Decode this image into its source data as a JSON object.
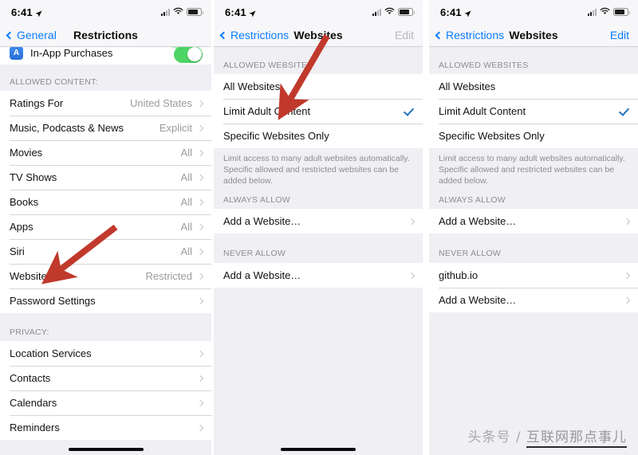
{
  "statusbar": {
    "time": "6:41",
    "location_icon": "location-arrow-icon",
    "signal_icon": "cellular-signal-icon",
    "wifi_icon": "wifi-icon",
    "battery_icon": "battery-icon"
  },
  "panel1": {
    "nav": {
      "back_label": "General",
      "title": "Restrictions",
      "right_label": ""
    },
    "partial_row": {
      "label": "In-App Purchases",
      "toggle_state": "on"
    },
    "sections": [
      {
        "header": "ALLOWED CONTENT:",
        "rows": [
          {
            "label": "Ratings For",
            "value": "United States",
            "accessory": "chevron"
          },
          {
            "label": "Music, Podcasts & News",
            "value": "Explicit",
            "accessory": "chevron"
          },
          {
            "label": "Movies",
            "value": "All",
            "accessory": "chevron"
          },
          {
            "label": "TV Shows",
            "value": "All",
            "accessory": "chevron"
          },
          {
            "label": "Books",
            "value": "All",
            "accessory": "chevron"
          },
          {
            "label": "Apps",
            "value": "All",
            "accessory": "chevron"
          },
          {
            "label": "Siri",
            "value": "All",
            "accessory": "chevron"
          },
          {
            "label": "Websites",
            "value": "Restricted",
            "accessory": "chevron"
          },
          {
            "label": "Password Settings",
            "value": "",
            "accessory": "chevron"
          }
        ]
      },
      {
        "header": "PRIVACY:",
        "rows": [
          {
            "label": "Location Services",
            "value": "",
            "accessory": "chevron"
          },
          {
            "label": "Contacts",
            "value": "",
            "accessory": "chevron"
          },
          {
            "label": "Calendars",
            "value": "",
            "accessory": "chevron"
          },
          {
            "label": "Reminders",
            "value": "",
            "accessory": "chevron"
          }
        ]
      }
    ]
  },
  "panel2": {
    "nav": {
      "back_label": "Restrictions",
      "title": "Websites",
      "right_label": "Edit",
      "right_enabled": false
    },
    "section_allowed_header": "ALLOWED WEBSITES",
    "allowed_rows": [
      {
        "label": "All Websites",
        "accessory": "none"
      },
      {
        "label": "Limit Adult Content",
        "accessory": "check"
      },
      {
        "label": "Specific Websites Only",
        "accessory": "none"
      }
    ],
    "footnote": "Limit access to many adult websites automatically. Specific allowed and restricted websites can be added below.",
    "always_allow_header": "ALWAYS ALLOW",
    "always_allow_rows": [
      {
        "label": "Add a Website…",
        "accessory": "chevron"
      }
    ],
    "never_allow_header": "NEVER ALLOW",
    "never_allow_rows": [
      {
        "label": "Add a Website…",
        "accessory": "chevron"
      }
    ]
  },
  "panel3": {
    "nav": {
      "back_label": "Restrictions",
      "title": "Websites",
      "right_label": "Edit",
      "right_enabled": true
    },
    "section_allowed_header": "ALLOWED WEBSITES",
    "allowed_rows": [
      {
        "label": "All Websites",
        "accessory": "none"
      },
      {
        "label": "Limit Adult Content",
        "accessory": "check"
      },
      {
        "label": "Specific Websites Only",
        "accessory": "none"
      }
    ],
    "footnote": "Limit access to many adult websites automatically. Specific allowed and restricted websites can be added below.",
    "always_allow_header": "ALWAYS ALLOW",
    "always_allow_rows": [
      {
        "label": "Add a Website…",
        "accessory": "chevron"
      }
    ],
    "never_allow_header": "NEVER ALLOW",
    "never_allow_rows": [
      {
        "label": "github.io",
        "accessory": "chevron"
      },
      {
        "label": "Add a Website…",
        "accessory": "chevron"
      }
    ]
  },
  "annotations": {
    "arrow_color": "#c0392b",
    "arrow1_target": "Websites",
    "arrow2_target": "Limit Adult Content"
  },
  "watermark": {
    "prefix": "头条号 / ",
    "name": "互联网那点事儿"
  },
  "colors": {
    "accent_blue": "#0a7cff",
    "check_blue": "#1f72c0",
    "toggle_green": "#4cd465",
    "group_bg": "#efeff4",
    "row_bg": "#ffffff",
    "secondary_text": "#9b9ba0"
  }
}
